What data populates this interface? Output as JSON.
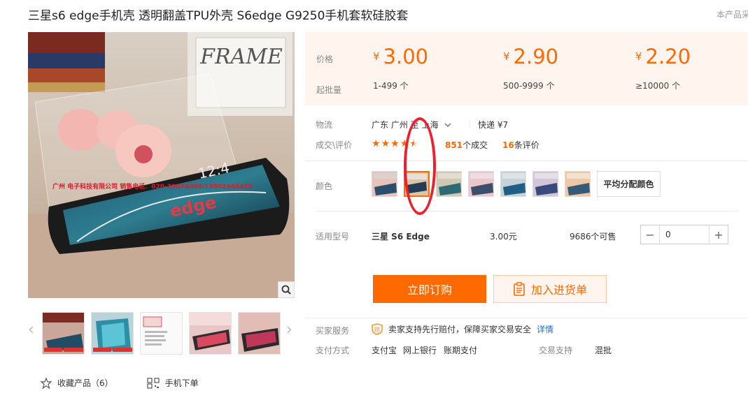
{
  "title": "三星s6 edge手机壳 透明翻盖TPU外壳 S6edge G9250手机套软硅胶套",
  "report": "本产品采",
  "main_image": {
    "watermark": "广州 电子科技有限公司 销售电话：020-29074090/13802446429",
    "frame_text": "FRAME",
    "phone_text": "edge",
    "clock_text": "12:4"
  },
  "price": {
    "price_label": "价格",
    "moq_label": "起批量",
    "currency": "¥",
    "tiers": [
      {
        "price": "3.00",
        "range": "1-499 个"
      },
      {
        "price": "2.90",
        "range": "500-9999 个"
      },
      {
        "price": "2.20",
        "range": "≥10000 个"
      }
    ]
  },
  "logistics": {
    "label": "物流",
    "route": "广东 广州 至 上海",
    "express": "快递 ¥7"
  },
  "deals": {
    "label": "成交\\评价",
    "rating": 4.5,
    "deal_count": "851",
    "deal_suffix": "个成交",
    "review_count": "16",
    "review_suffix": "条评价"
  },
  "color": {
    "label": "颜色",
    "swatches": [
      "color-1",
      "color-2",
      "color-3",
      "color-4",
      "color-5",
      "color-6",
      "color-7"
    ],
    "selected_index": 1,
    "assign_label": "平均分配颜色"
  },
  "model": {
    "label": "适用型号",
    "name": "三星 S6 Edge",
    "price": "3.00元",
    "stock": "9686个可售",
    "quantity": "0"
  },
  "buttons": {
    "order": "立即订购",
    "cart": "加入进货单"
  },
  "service": {
    "label": "买家服务",
    "text": "卖家支持先行赔付，保障买家交易安全",
    "link": "详情"
  },
  "payment": {
    "label": "支付方式",
    "methods": [
      "支付宝",
      "网上银行",
      "账期支付"
    ],
    "trade_label": "交易支持",
    "trade_value": "混批"
  },
  "bottom": {
    "favorite": "收藏产品（6）",
    "mobile": "手机下单"
  },
  "colors": {
    "accent": "#ff6a00",
    "price_bg": "#fff5ee",
    "annotation": "#ee2030"
  }
}
